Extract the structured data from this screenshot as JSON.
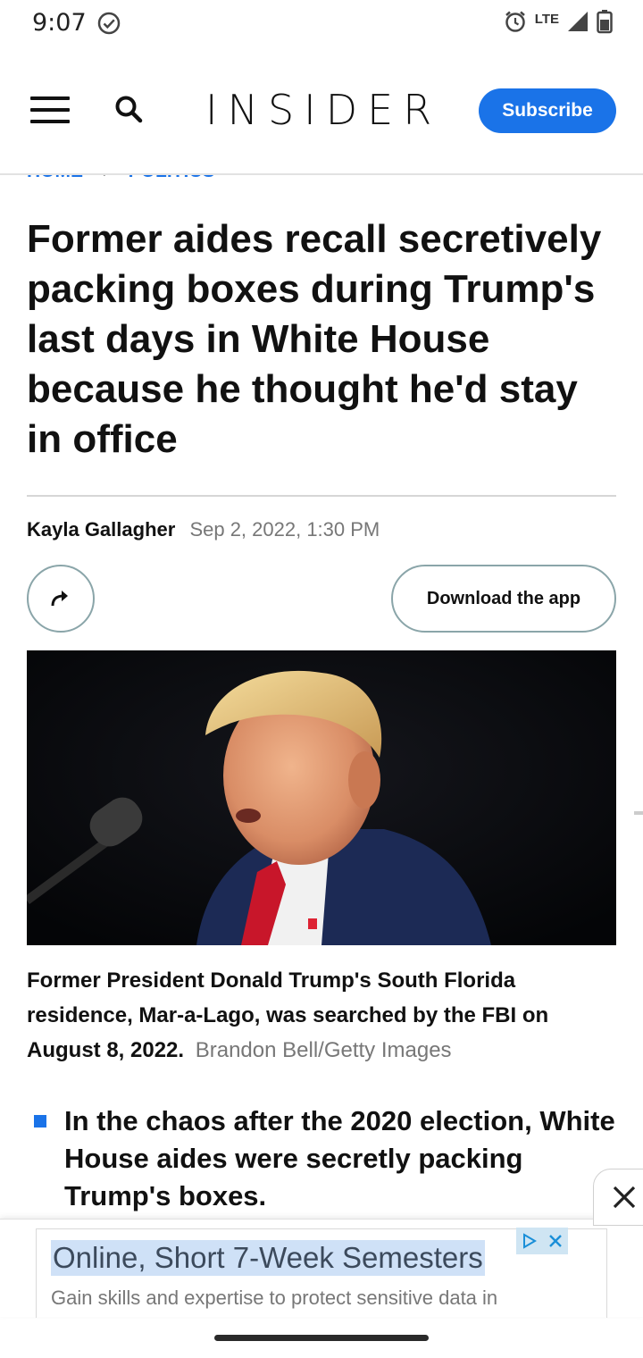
{
  "status_bar": {
    "time": "9:07",
    "network": "LTE"
  },
  "header": {
    "logo": "INSIDER",
    "subscribe_label": "Subscribe",
    "accent_color": "#1a73e8"
  },
  "breadcrumb": {
    "items": [
      "HOME",
      "POLITICS"
    ]
  },
  "article": {
    "headline": "Former aides recall secretively packing boxes during Trump's last days in White House because he thought he'd stay in office",
    "author": "Kayla Gallagher",
    "date": "Sep 2, 2022, 1:30 PM",
    "download_label": "Download the app",
    "caption": "Former President Donald Trump's South Florida residence, Mar-a-Lago, was searched by the FBI on August 8, 2022.",
    "photo_credit": "Brandon Bell/Getty Images",
    "bullets": [
      "In the chaos after the 2020 election, White House aides were secretly packing Trump's boxes."
    ]
  },
  "ad": {
    "title": "Online, Short 7-Week Semesters",
    "description": "Gain skills and expertise to protect sensitive data in"
  }
}
